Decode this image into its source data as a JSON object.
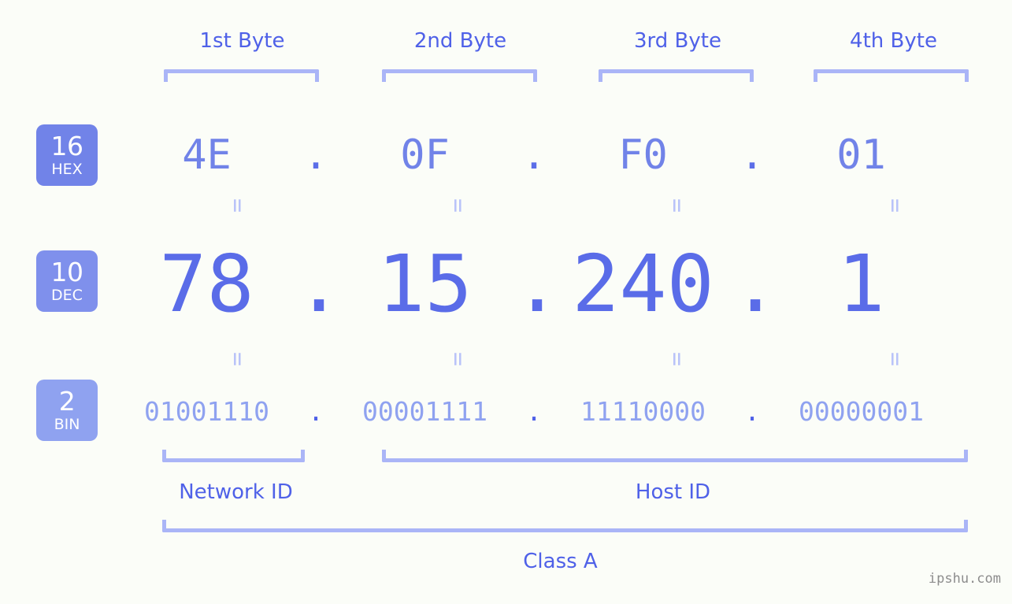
{
  "page": {
    "background_color": "#fbfdf8",
    "watermark": "ipshu.com"
  },
  "colors": {
    "accent_dark": "#4f61e8",
    "accent": "#5a6ce8",
    "accent_mid": "#7183e8",
    "accent_light": "#8fa2f0",
    "bracket": "#aab5f7",
    "equals": "#b9c3f9",
    "badge_hex": "#7183e8",
    "badge_dec": "#7f90ec",
    "badge_bin": "#8fa2f0",
    "watermark": "#8d8d8d"
  },
  "byte_headers": [
    {
      "label": "1st Byte"
    },
    {
      "label": "2nd Byte"
    },
    {
      "label": "3rd Byte"
    },
    {
      "label": "4th Byte"
    }
  ],
  "bases": [
    {
      "number": "16",
      "abbr": "HEX"
    },
    {
      "number": "10",
      "abbr": "DEC"
    },
    {
      "number": "2",
      "abbr": "BIN"
    }
  ],
  "rows": {
    "hex": {
      "base_number": "16",
      "base_abbr": "HEX",
      "values": [
        "4E",
        "0F",
        "F0",
        "01"
      ],
      "separator": "."
    },
    "dec": {
      "base_number": "10",
      "base_abbr": "DEC",
      "values": [
        "78",
        "15",
        "240",
        "1"
      ],
      "separator": "."
    },
    "bin": {
      "base_number": "2",
      "base_abbr": "BIN",
      "values": [
        "01001110",
        "00001111",
        "11110000",
        "00000001"
      ],
      "separator": "."
    }
  },
  "equals_marks": {
    "symbol": "=",
    "count_top": 4,
    "count_bottom": 4
  },
  "footer": {
    "network_id_label": "Network ID",
    "host_id_label": "Host ID",
    "class_label": "Class A"
  }
}
